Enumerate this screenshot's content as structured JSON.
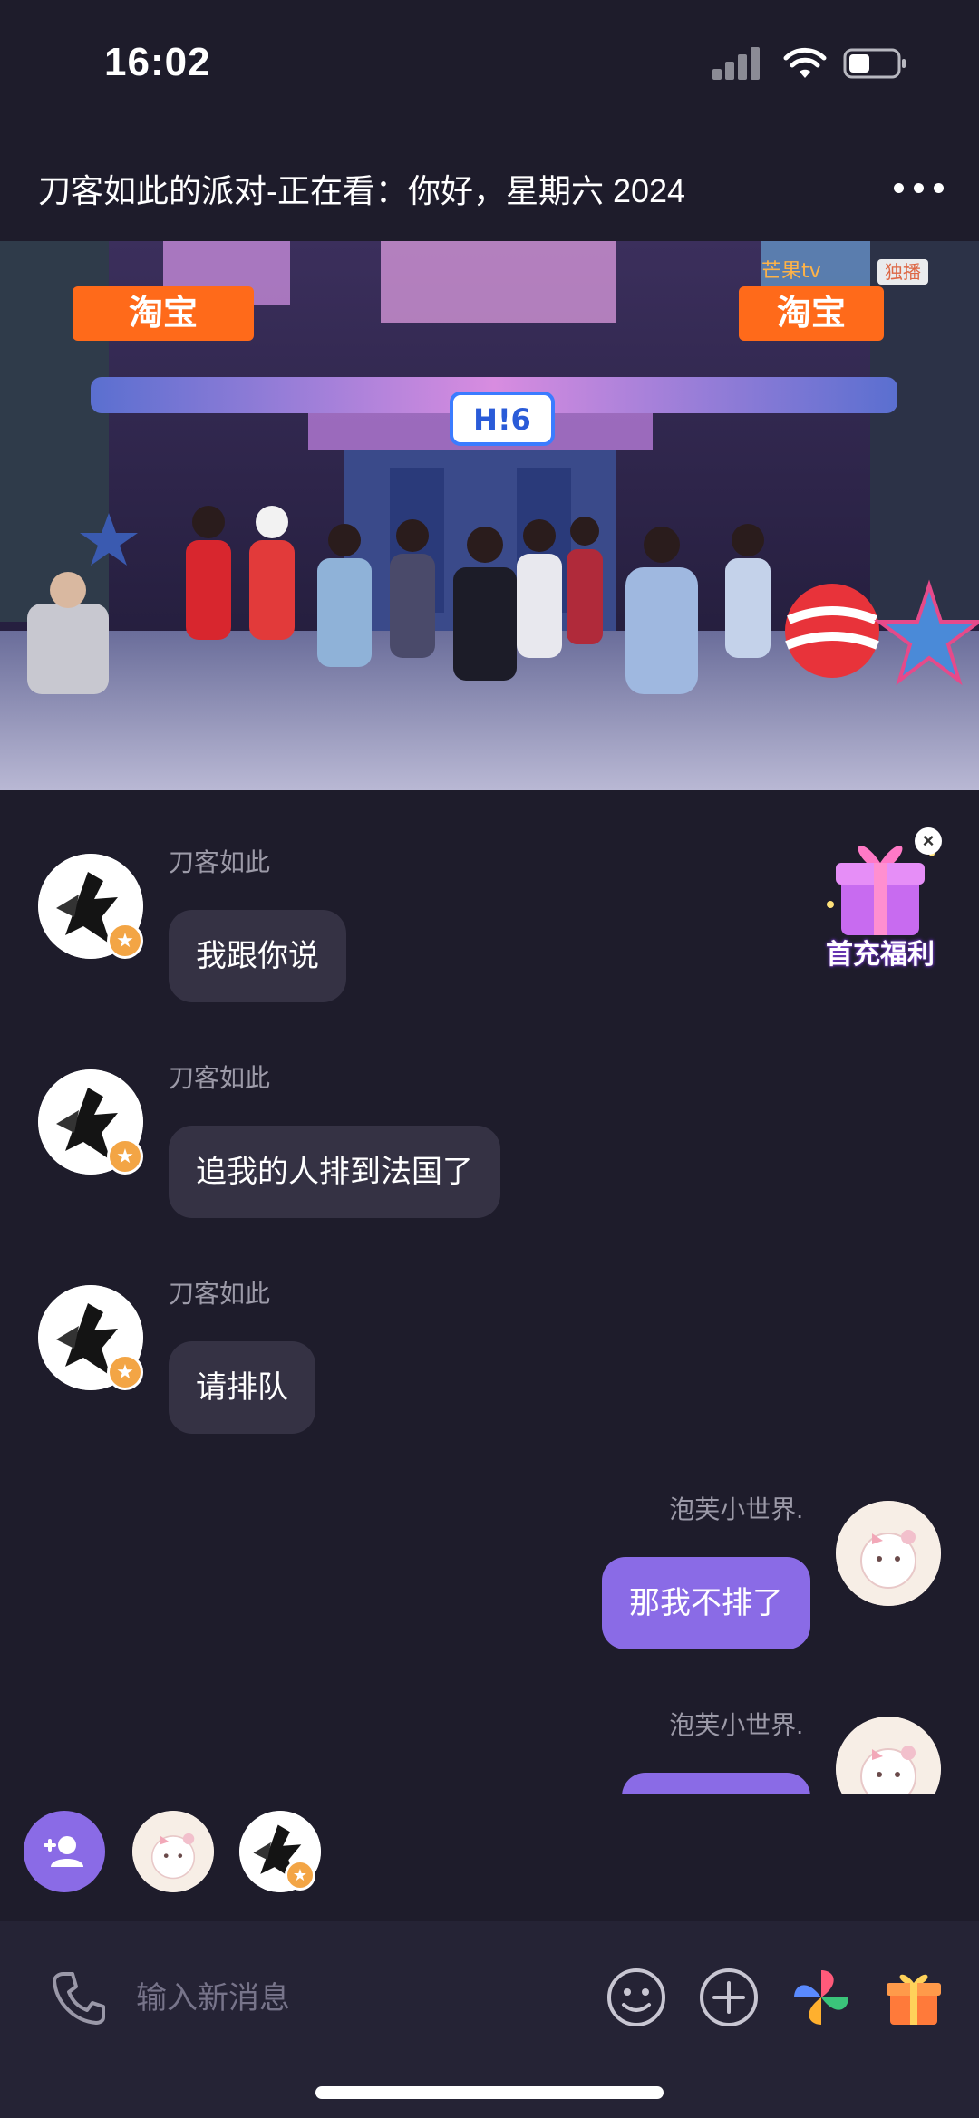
{
  "status_bar": {
    "time": "16:02"
  },
  "header": {
    "title": "刀客如此的派对-正在看：你好，星期六 2024"
  },
  "video": {
    "brand_left": "淘宝",
    "brand_right": "淘宝",
    "channel": "芒果tv",
    "channel_tag": "独播",
    "stage_sign": "H!6"
  },
  "promo": {
    "label": "首充福利",
    "close": "×"
  },
  "messages": [
    {
      "sender": "刀客如此",
      "text": "我跟你说",
      "side": "left"
    },
    {
      "sender": "刀客如此",
      "text": "追我的人排到法国了",
      "side": "left"
    },
    {
      "sender": "刀客如此",
      "text": "请排队",
      "side": "left"
    },
    {
      "sender": "泡芙小世界.",
      "text": "那我不排了",
      "side": "right"
    },
    {
      "sender": "泡芙小世界.",
      "text": "",
      "side": "right"
    }
  ],
  "input": {
    "placeholder": "输入新消息"
  },
  "icons": {
    "signal": "cellular-signal-icon",
    "wifi": "wifi-icon",
    "battery": "battery-icon",
    "more": "more-icon",
    "add_member": "add-member-icon",
    "phone": "phone-icon",
    "emoji": "emoji-icon",
    "plus": "plus-icon",
    "pinwheel": "pinwheel-icon",
    "gift": "gift-icon"
  },
  "colors": {
    "background": "#1e1c2b",
    "bubble_incoming": "#353244",
    "bubble_outgoing": "#8a6be6",
    "badge": "#f3a545"
  }
}
